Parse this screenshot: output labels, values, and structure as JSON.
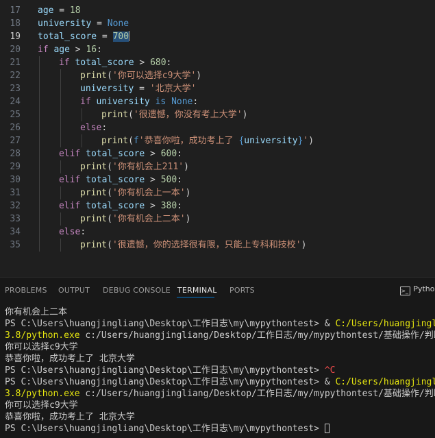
{
  "editor": {
    "lines": [
      {
        "n": "17",
        "tokens": [
          [
            "var",
            "age"
          ],
          [
            "op",
            " = "
          ],
          [
            "num",
            "18"
          ]
        ]
      },
      {
        "n": "18",
        "tokens": [
          [
            "var",
            "university"
          ],
          [
            "op",
            " = "
          ],
          [
            "kw",
            "None"
          ]
        ]
      },
      {
        "n": "19",
        "active": true,
        "tokens": [
          [
            "var",
            "total_score"
          ],
          [
            "op",
            " = "
          ],
          [
            "sel",
            "700"
          ],
          [
            "cursor",
            ""
          ]
        ]
      },
      {
        "n": "20",
        "tokens": [
          [
            "ctl",
            "if"
          ],
          [
            "op",
            " "
          ],
          [
            "var",
            "age"
          ],
          [
            "op",
            " > "
          ],
          [
            "num",
            "16"
          ],
          [
            "pun",
            ":"
          ]
        ]
      },
      {
        "n": "21",
        "indent": 1,
        "tokens": [
          [
            "ctl",
            "if"
          ],
          [
            "op",
            " "
          ],
          [
            "var",
            "total_score"
          ],
          [
            "op",
            " > "
          ],
          [
            "num",
            "680"
          ],
          [
            "pun",
            ":"
          ]
        ]
      },
      {
        "n": "22",
        "indent": 2,
        "tokens": [
          [
            "fn",
            "print"
          ],
          [
            "pun",
            "("
          ],
          [
            "str",
            "'你可以选择c9大学'"
          ],
          [
            "pun",
            ")"
          ]
        ]
      },
      {
        "n": "23",
        "indent": 2,
        "tokens": [
          [
            "var",
            "university"
          ],
          [
            "op",
            " = "
          ],
          [
            "str",
            "'北京大学'"
          ]
        ]
      },
      {
        "n": "24",
        "indent": 2,
        "tokens": [
          [
            "ctl",
            "if"
          ],
          [
            "op",
            " "
          ],
          [
            "var",
            "university"
          ],
          [
            "op",
            " "
          ],
          [
            "kw",
            "is"
          ],
          [
            "op",
            " "
          ],
          [
            "kw",
            "None"
          ],
          [
            "pun",
            ":"
          ]
        ]
      },
      {
        "n": "25",
        "indent": 3,
        "tokens": [
          [
            "fn",
            "print"
          ],
          [
            "pun",
            "("
          ],
          [
            "str",
            "'很遗憾，你没有考上大学'"
          ],
          [
            "pun",
            ")"
          ]
        ]
      },
      {
        "n": "26",
        "indent": 2,
        "tokens": [
          [
            "ctl",
            "else"
          ],
          [
            "pun",
            ":"
          ]
        ]
      },
      {
        "n": "27",
        "indent": 3,
        "tokens": [
          [
            "fn",
            "print"
          ],
          [
            "pun",
            "("
          ],
          [
            "kw",
            "f"
          ],
          [
            "str",
            "'恭喜你啦，成功考上了 "
          ],
          [
            "kw",
            "{"
          ],
          [
            "var",
            "university"
          ],
          [
            "kw",
            "}"
          ],
          [
            "str",
            "'"
          ],
          [
            "pun",
            ")"
          ]
        ]
      },
      {
        "n": "28",
        "indent": 1,
        "tokens": [
          [
            "ctl",
            "elif"
          ],
          [
            "op",
            " "
          ],
          [
            "var",
            "total_score"
          ],
          [
            "op",
            " > "
          ],
          [
            "num",
            "600"
          ],
          [
            "pun",
            ":"
          ]
        ]
      },
      {
        "n": "29",
        "indent": 2,
        "tokens": [
          [
            "fn",
            "print"
          ],
          [
            "pun",
            "("
          ],
          [
            "str",
            "'你有机会上211'"
          ],
          [
            "pun",
            ")"
          ]
        ]
      },
      {
        "n": "30",
        "indent": 1,
        "tokens": [
          [
            "ctl",
            "elif"
          ],
          [
            "op",
            " "
          ],
          [
            "var",
            "total_score"
          ],
          [
            "op",
            " > "
          ],
          [
            "num",
            "500"
          ],
          [
            "pun",
            ":"
          ]
        ]
      },
      {
        "n": "31",
        "indent": 2,
        "tokens": [
          [
            "fn",
            "print"
          ],
          [
            "pun",
            "("
          ],
          [
            "str",
            "'你有机会上一本'"
          ],
          [
            "pun",
            ")"
          ]
        ]
      },
      {
        "n": "32",
        "indent": 1,
        "tokens": [
          [
            "ctl",
            "elif"
          ],
          [
            "op",
            " "
          ],
          [
            "var",
            "total_score"
          ],
          [
            "op",
            " > "
          ],
          [
            "num",
            "380"
          ],
          [
            "pun",
            ":"
          ]
        ]
      },
      {
        "n": "33",
        "indent": 2,
        "tokens": [
          [
            "fn",
            "print"
          ],
          [
            "pun",
            "("
          ],
          [
            "str",
            "'你有机会上二本'"
          ],
          [
            "pun",
            ")"
          ]
        ]
      },
      {
        "n": "34",
        "indent": 1,
        "tokens": [
          [
            "ctl",
            "else"
          ],
          [
            "pun",
            ":"
          ]
        ]
      },
      {
        "n": "35",
        "indent": 2,
        "tokens": [
          [
            "fn",
            "print"
          ],
          [
            "pun",
            "("
          ],
          [
            "str",
            "'很遗憾，你的选择很有限，只能上专科和技校'"
          ],
          [
            "pun",
            ")"
          ]
        ]
      }
    ]
  },
  "panel": {
    "tabs": {
      "problems": "PROBLEMS",
      "output": "OUTPUT",
      "debug_console": "DEBUG CONSOLE",
      "terminal": "TERMINAL",
      "ports": "PORTS"
    },
    "active_tab": "terminal",
    "profile_label": "Pythor",
    "profile_icon": "terminal-icon"
  },
  "terminal": {
    "lines": [
      [
        [
          "plain",
          "你有机会上二本"
        ]
      ],
      [
        [
          "plain",
          "PS C:\\Users\\huangjingliang\\Desktop\\工作日志\\my\\mypythontest> & "
        ],
        [
          "yel",
          "C:/Users/huangjingliang/.cc"
        ]
      ],
      [
        [
          "yel",
          "3.8/python.exe"
        ],
        [
          "plain",
          " c:/Users/huangjingliang/Desktop/工作日志/my/mypythontest/基础操作/判断语句."
        ]
      ],
      [
        [
          "plain",
          "你可以选择c9大学"
        ]
      ],
      [
        [
          "plain",
          "恭喜你啦，成功考上了 北京大学"
        ]
      ],
      [
        [
          "plain",
          "PS C:\\Users\\huangjingliang\\Desktop\\工作日志\\my\\mypythontest> "
        ],
        [
          "red",
          "^C"
        ]
      ],
      [
        [
          "plain",
          "PS C:\\Users\\huangjingliang\\Desktop\\工作日志\\my\\mypythontest> & "
        ],
        [
          "yel",
          "C:/Users/huangjingliang/.cc"
        ]
      ],
      [
        [
          "yel",
          "3.8/python.exe"
        ],
        [
          "plain",
          " c:/Users/huangjingliang/Desktop/工作日志/my/mypythontest/基础操作/判断语句."
        ]
      ],
      [
        [
          "plain",
          "你可以选择c9大学"
        ]
      ],
      [
        [
          "plain",
          "恭喜你啦，成功考上了 北京大学"
        ]
      ],
      [
        [
          "plain",
          "PS C:\\Users\\huangjingliang\\Desktop\\工作日志\\my\\mypythontest> "
        ],
        [
          "cursor",
          ""
        ]
      ]
    ]
  }
}
